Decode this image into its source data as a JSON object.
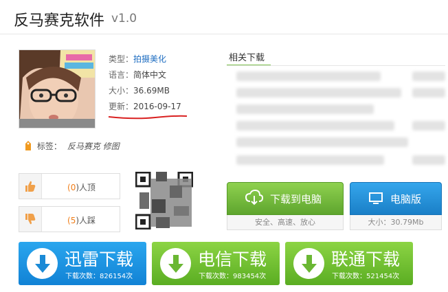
{
  "header": {
    "title": "反马赛克软件",
    "version": "v1.0"
  },
  "info": {
    "type_label": "类型：",
    "type_value": "拍摄美化",
    "lang_label": "语言：",
    "lang_value": "简体中文",
    "size_label": "大小：",
    "size_value": "36.69MB",
    "update_label": "更新：",
    "update_value": "2016-09-17"
  },
  "tags": {
    "label": "标签：",
    "value": "反马赛克 修图"
  },
  "votes": {
    "up": {
      "prefix": "(",
      "count": "0",
      "suffix": ")人顶"
    },
    "down": {
      "prefix": "(",
      "count": "5",
      "suffix": ")人踩"
    }
  },
  "related": {
    "title": "相关下载"
  },
  "actions": {
    "pc_download": {
      "label": "下载到电脑",
      "sub": "安全、高速、放心"
    },
    "desktop": {
      "label": "电脑版",
      "sub": "大小：30.79Mb"
    }
  },
  "downloads": [
    {
      "label": "迅雷下载",
      "count_text": "下载次数：826154次"
    },
    {
      "label": "电信下载",
      "count_text": "下载次数：983454次"
    },
    {
      "label": "联通下载",
      "count_text": "下载次数：521454次"
    }
  ],
  "colors": {
    "link": "#1e6dc1",
    "green": "#6ab733",
    "blue": "#1a8ad6",
    "orange": "#f07d18",
    "underline": "#d92020"
  }
}
